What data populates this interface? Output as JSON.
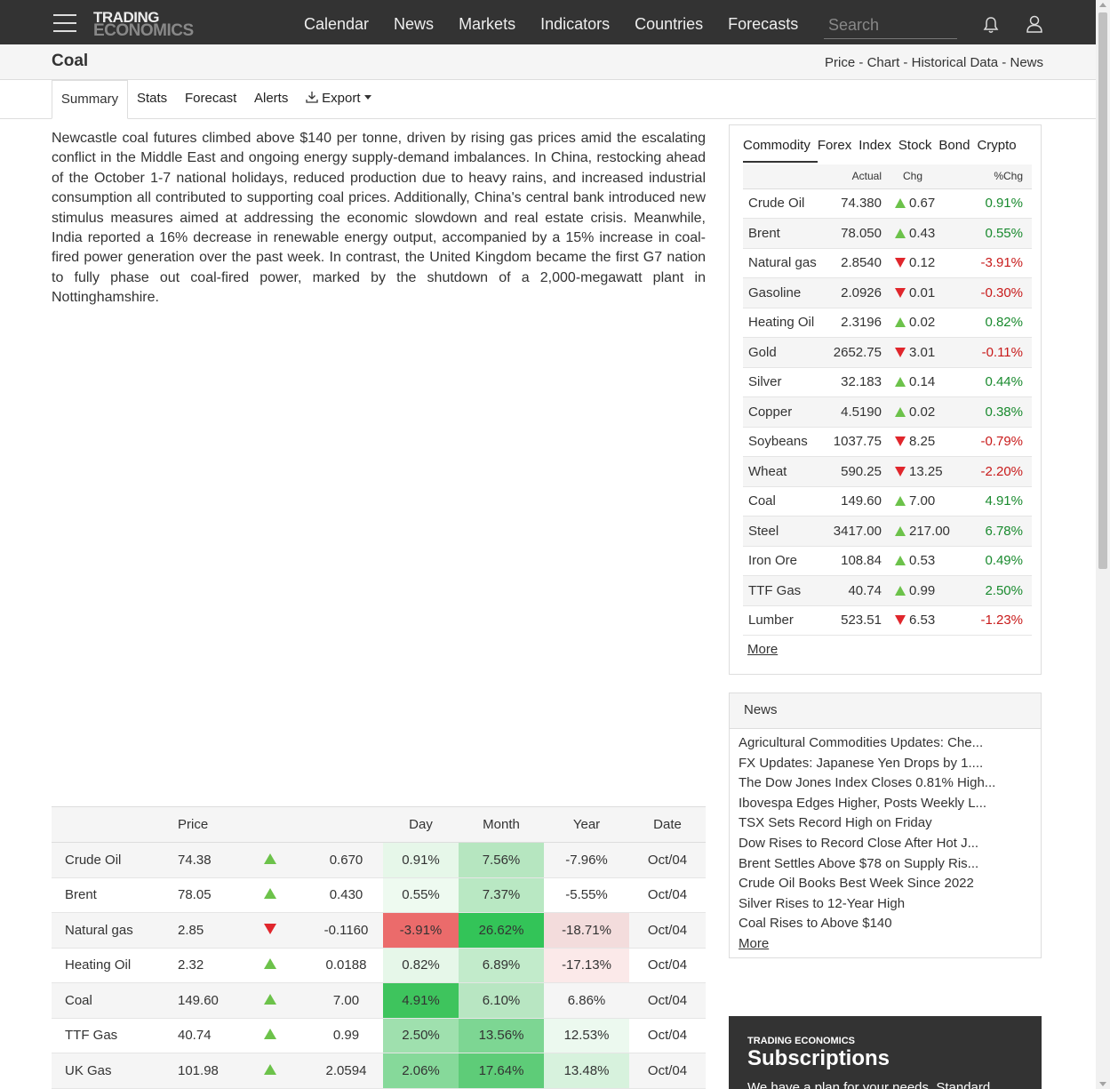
{
  "header": {
    "logo_line1": "TRADING",
    "logo_line2": "ECONOMICS",
    "nav": [
      "Calendar",
      "News",
      "Markets",
      "Indicators",
      "Countries",
      "Forecasts"
    ],
    "search_placeholder": "Search"
  },
  "title": {
    "page_title": "Coal",
    "crumbs": [
      "Price",
      "Chart",
      "Historical Data",
      "News"
    ],
    "crumb_sep": " - "
  },
  "tabs": {
    "summary": "Summary",
    "stats": "Stats",
    "forecast": "Forecast",
    "alerts": "Alerts",
    "export": "Export"
  },
  "summary_text": "Newcastle coal futures climbed above $140 per tonne, driven by rising gas prices amid the escalating conflict in the Middle East and ongoing energy supply-demand imbalances. In China, restocking ahead of the October 1-7 national holidays, reduced production due to heavy rains, and increased industrial consumption all contributed to supporting coal prices. Additionally, China's central bank introduced new stimulus measures aimed at addressing the economic slowdown and real estate crisis. Meanwhile, India reported a 16% decrease in renewable energy output, accompanied by a 15% increase in coal-fired power generation over the past week. In contrast, the United Kingdom became the first G7 nation to fully phase out coal-fired power, marked by the shutdown of a 2,000-megawatt plant in Nottinghamshire.",
  "main_table": {
    "headers": [
      "",
      "Price",
      "",
      "",
      "Day",
      "Month",
      "Year",
      "Date"
    ],
    "rows": [
      {
        "name": "Crude Oil",
        "price": "74.38",
        "dir": "up",
        "chg": "0.670",
        "day": "0.91%",
        "month": "7.56%",
        "year": "-7.96%",
        "date": "Oct/04",
        "day_bg": "#e6f7e9",
        "month_bg": "#b6e6c0",
        "year_bg": ""
      },
      {
        "name": "Brent",
        "price": "78.05",
        "dir": "up",
        "chg": "0.430",
        "day": "0.55%",
        "month": "7.37%",
        "year": "-5.55%",
        "date": "Oct/04",
        "day_bg": "#eefaf0",
        "month_bg": "#b9e8c3",
        "year_bg": ""
      },
      {
        "name": "Natural gas",
        "price": "2.85",
        "dir": "down",
        "chg": "-0.1160",
        "day": "-3.91%",
        "month": "26.62%",
        "year": "-18.71%",
        "date": "Oct/04",
        "day_bg": "#eb6b6b",
        "month_bg": "#33c458",
        "year_bg": "#f3dcdc"
      },
      {
        "name": "Heating Oil",
        "price": "2.32",
        "dir": "up",
        "chg": "0.0188",
        "day": "0.82%",
        "month": "6.89%",
        "year": "-17.13%",
        "date": "Oct/04",
        "day_bg": "#e6f7e9",
        "month_bg": "#c2ebcb",
        "year_bg": "#fbe9e9"
      },
      {
        "name": "Coal",
        "price": "149.60",
        "dir": "up",
        "chg": "7.00",
        "day": "4.91%",
        "month": "6.10%",
        "year": "6.86%",
        "date": "Oct/04",
        "day_bg": "#3ec45d",
        "month_bg": "#b8e6c2",
        "year_bg": ""
      },
      {
        "name": "TTF Gas",
        "price": "40.74",
        "dir": "up",
        "chg": "0.99",
        "day": "2.50%",
        "month": "13.56%",
        "year": "12.53%",
        "date": "Oct/04",
        "day_bg": "#9fe0ae",
        "month_bg": "#7dd693",
        "year_bg": "#ecf9ef"
      },
      {
        "name": "UK Gas",
        "price": "101.98",
        "dir": "up",
        "chg": "2.0594",
        "day": "2.06%",
        "month": "17.64%",
        "year": "13.48%",
        "date": "Oct/04",
        "day_bg": "#86d99a",
        "month_bg": "#5ecc78",
        "year_bg": "#d7f2dd"
      }
    ]
  },
  "widget": {
    "tabs": [
      "Commodity",
      "Forex",
      "Index",
      "Stock",
      "Bond",
      "Crypto"
    ],
    "headers": [
      "",
      "Actual",
      "Chg",
      "%Chg"
    ],
    "rows": [
      {
        "name": "Crude Oil",
        "actual": "74.380",
        "dir": "up",
        "chg": "0.67",
        "pct": "0.91%"
      },
      {
        "name": "Brent",
        "actual": "78.050",
        "dir": "up",
        "chg": "0.43",
        "pct": "0.55%"
      },
      {
        "name": "Natural gas",
        "actual": "2.8540",
        "dir": "down",
        "chg": "0.12",
        "pct": "-3.91%"
      },
      {
        "name": "Gasoline",
        "actual": "2.0926",
        "dir": "down",
        "chg": "0.01",
        "pct": "-0.30%"
      },
      {
        "name": "Heating Oil",
        "actual": "2.3196",
        "dir": "up",
        "chg": "0.02",
        "pct": "0.82%"
      },
      {
        "name": "Gold",
        "actual": "2652.75",
        "dir": "down",
        "chg": "3.01",
        "pct": "-0.11%"
      },
      {
        "name": "Silver",
        "actual": "32.183",
        "dir": "up",
        "chg": "0.14",
        "pct": "0.44%"
      },
      {
        "name": "Copper",
        "actual": "4.5190",
        "dir": "up",
        "chg": "0.02",
        "pct": "0.38%"
      },
      {
        "name": "Soybeans",
        "actual": "1037.75",
        "dir": "down",
        "chg": "8.25",
        "pct": "-0.79%"
      },
      {
        "name": "Wheat",
        "actual": "590.25",
        "dir": "down",
        "chg": "13.25",
        "pct": "-2.20%"
      },
      {
        "name": "Coal",
        "actual": "149.60",
        "dir": "up",
        "chg": "7.00",
        "pct": "4.91%"
      },
      {
        "name": "Steel",
        "actual": "3417.00",
        "dir": "up",
        "chg": "217.00",
        "pct": "6.78%"
      },
      {
        "name": "Iron Ore",
        "actual": "108.84",
        "dir": "up",
        "chg": "0.53",
        "pct": "0.49%"
      },
      {
        "name": "TTF Gas",
        "actual": "40.74",
        "dir": "up",
        "chg": "0.99",
        "pct": "2.50%"
      },
      {
        "name": "Lumber",
        "actual": "523.51",
        "dir": "down",
        "chg": "6.53",
        "pct": "-1.23%"
      }
    ],
    "more": "More"
  },
  "news": {
    "title": "News",
    "items": [
      "Agricultural Commodities Updates: Che...",
      "FX Updates: Japanese Yen Drops by 1....",
      "The Dow Jones Index Closes 0.81% High...",
      "Ibovespa Edges Higher, Posts Weekly L...",
      "TSX Sets Record High on Friday",
      "Dow Rises to Record Close After Hot J...",
      "Brent Settles Above $78 on Supply Ris...",
      "Crude Oil Books Best Week Since 2022",
      "Silver Rises to 12-Year High",
      "Coal Rises to Above $140"
    ],
    "more": "More"
  },
  "subscriptions": {
    "small": "TRADING ECONOMICS",
    "title": "Subscriptions",
    "text": "We have a plan for your needs. Standard"
  },
  "colors": {
    "topbar": "#333333",
    "up": "#6cc24a",
    "down": "#e0262c",
    "pos_text": "#198a2e",
    "neg_text": "#c81a1a"
  }
}
